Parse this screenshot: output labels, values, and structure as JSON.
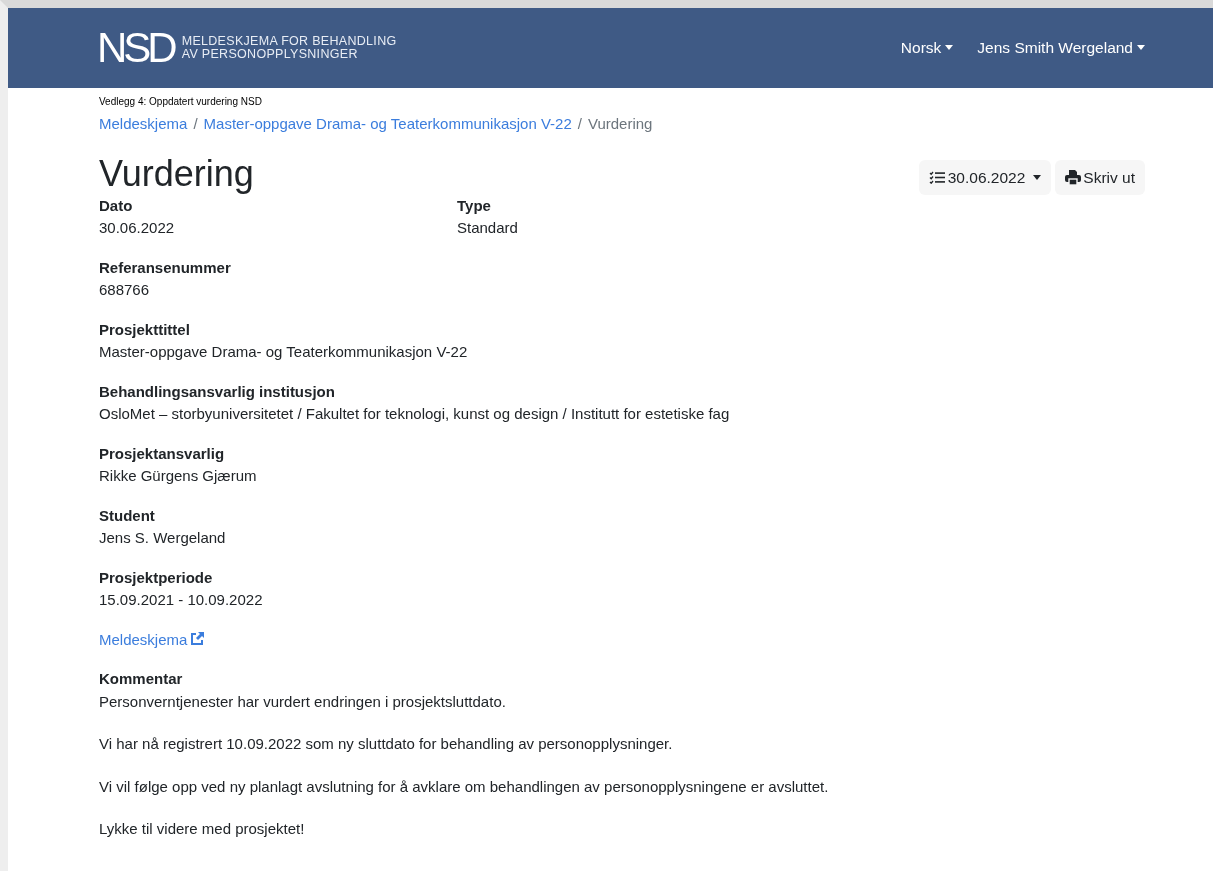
{
  "header": {
    "logo": "NSD",
    "logo_caption_lines": [
      "MELDESKJEMA FOR BEHANDLING",
      "AV PERSONOPPLYSNINGER"
    ],
    "menus": [
      {
        "label": "Norsk"
      },
      {
        "label": "Jens Smith Wergeland"
      }
    ]
  },
  "attachment_note": "Vedlegg 4: Oppdatert vurdering NSD",
  "breadcrumb_separator": "/",
  "breadcrumb": [
    {
      "label": "Meldeskjema",
      "kind": "link"
    },
    {
      "label": "Master-oppgave Drama- og Teaterkommunikasjon V-22",
      "kind": "link"
    },
    {
      "label": "Vurdering",
      "kind": "current"
    }
  ],
  "page_title": "Vurdering",
  "actions": {
    "version_button": "30.06.2022",
    "print_button": "Skriv ut"
  },
  "fields_row": [
    {
      "label": "Dato",
      "value": "30.06.2022"
    },
    {
      "label": "Type",
      "value": "Standard"
    }
  ],
  "fields": [
    {
      "label": "Referansenummer",
      "value": "688766"
    },
    {
      "label": "Prosjekttittel",
      "value": "Master-oppgave Drama- og Teaterkommunikasjon V-22"
    },
    {
      "label": "Behandlingsansvarlig institusjon",
      "value": "OsloMet – storbyuniversitetet / Fakultet for teknologi, kunst og design / Institutt for estetiske fag"
    },
    {
      "label": "Prosjektansvarlig",
      "value": "Rikke Gürgens Gjærum"
    },
    {
      "label": "Student",
      "value": "Jens S. Wergeland"
    },
    {
      "label": "Prosjektperiode",
      "value": "15.09.2021 - 10.09.2022"
    }
  ],
  "external_link": "Meldeskjema",
  "comment": {
    "label": "Kommentar",
    "paragraphs": [
      "Personverntjenester har vurdert endringen i prosjektsluttdato.",
      "Vi har nå registrert 10.09.2022 som ny sluttdato for behandling av personopplysninger.",
      "Vi vil følge opp ved ny planlagt avslutning for å avklare om behandlingen av personopplysningene er avsluttet.",
      "Lykke til videre med prosjektet!"
    ]
  }
}
